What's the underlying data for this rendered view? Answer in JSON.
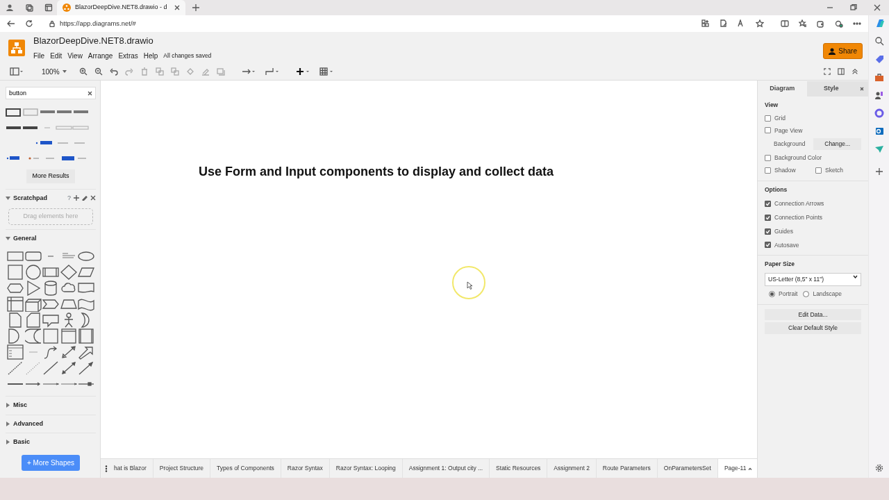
{
  "browser": {
    "tab_title": "BlazorDeepDive.NET8.drawio - d",
    "url": "https://app.diagrams.net/#"
  },
  "app": {
    "file_title": "BlazorDeepDive.NET8.drawio",
    "menu": [
      "File",
      "Edit",
      "View",
      "Arrange",
      "Extras",
      "Help"
    ],
    "save_status": "All changes saved",
    "share_label": "Share"
  },
  "toolbar": {
    "zoom": "100%"
  },
  "left_panel": {
    "search": {
      "value": "button"
    },
    "more_results": "More Results",
    "sections": [
      {
        "kind": "scratchpad",
        "title": "Scratchpad",
        "expanded": true,
        "help": "?",
        "drop_hint": "Drag elements here"
      },
      {
        "kind": "shapes",
        "title": "General",
        "expanded": true
      },
      {
        "kind": "shapes",
        "title": "Misc",
        "expanded": false
      },
      {
        "kind": "shapes",
        "title": "Advanced",
        "expanded": false
      },
      {
        "kind": "shapes",
        "title": "Basic",
        "expanded": false
      }
    ],
    "more_shapes": "+ More Shapes"
  },
  "canvas": {
    "text": "Use Form and Input components to display and collect data"
  },
  "format_panel": {
    "tabs": [
      {
        "label": "Diagram",
        "selected": true
      },
      {
        "label": "Style",
        "selected": false
      }
    ],
    "view": {
      "title": "View",
      "grid": {
        "label": "Grid",
        "checked": false
      },
      "page_view": {
        "label": "Page View",
        "checked": false
      },
      "background_label": "Background",
      "change_button": "Change...",
      "background_color": {
        "label": "Background Color",
        "checked": false
      },
      "shadow": {
        "label": "Shadow",
        "checked": false
      },
      "sketch": {
        "label": "Sketch",
        "checked": false
      }
    },
    "options": {
      "title": "Options",
      "items": [
        {
          "label": "Connection Arrows",
          "checked": true
        },
        {
          "label": "Connection Points",
          "checked": true
        },
        {
          "label": "Guides",
          "checked": true
        },
        {
          "label": "Autosave",
          "checked": true
        }
      ]
    },
    "paper_size": {
      "title": "Paper Size",
      "value": "US-Letter (8,5\" x 11\")",
      "orientations": [
        {
          "label": "Portrait",
          "selected": true
        },
        {
          "label": "Landscape",
          "selected": false
        }
      ]
    },
    "buttons": [
      "Edit Data...",
      "Clear Default Style"
    ]
  },
  "page_tabs": [
    {
      "label": "hat is Blazor",
      "selected": false
    },
    {
      "label": "Project Structure",
      "selected": false
    },
    {
      "label": "Types of Components",
      "selected": false
    },
    {
      "label": "Razor Syntax",
      "selected": false
    },
    {
      "label": "Razor Syntax: Looping",
      "selected": false
    },
    {
      "label": "Assignment 1: Output city ...",
      "selected": false
    },
    {
      "label": "Static Resources",
      "selected": false
    },
    {
      "label": "Assignment 2",
      "selected": false
    },
    {
      "label": "Route Parameters",
      "selected": false
    },
    {
      "label": "OnParametersSet",
      "selected": false
    },
    {
      "label": "Page-11",
      "selected": true
    }
  ]
}
